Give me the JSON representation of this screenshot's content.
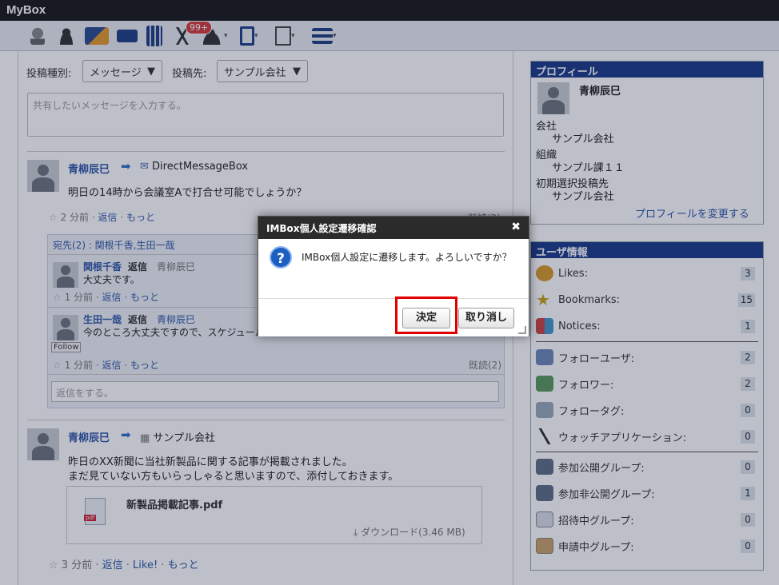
{
  "app": {
    "title": "MyBox"
  },
  "toolbar": {
    "badge": "99+"
  },
  "compose": {
    "type_label": "投稿種別:",
    "type_value": "メッセージ",
    "dest_label": "投稿先:",
    "dest_value": "サンプル会社",
    "placeholder": "共有したいメッセージを入力する。"
  },
  "post1": {
    "author": "青柳辰巳",
    "dest": "DirectMessageBox",
    "body": "明日の14時から会議室Aで打合せ可能でしょうか？",
    "time": "2 分前",
    "reply": "返信",
    "more": "もっと",
    "read": "既読(2)",
    "recipients": "宛先(2) : 関根千香,生田一哉",
    "replies": [
      {
        "author": "関根千香",
        "reply_label": "返信",
        "to": "青柳辰巳",
        "body": "大丈夫です。",
        "time": "1 分前",
        "reply": "返信",
        "more": "もっと"
      },
      {
        "author": "生田一哉",
        "reply_label": "返信",
        "to": "青柳辰巳",
        "body": "今のところ大丈夫ですので、スケジュール",
        "time": "1 分前",
        "reply": "返信",
        "more": "もっと",
        "follow": "Follow",
        "read": "既読(2)"
      }
    ],
    "reply_placeholder": "返信をする。"
  },
  "post2": {
    "author": "青柳辰巳",
    "dest": "サンプル会社",
    "body1": "昨日のXX新聞に当社新製品に関する記事が掲載されました。",
    "body2": "まだ見ていない方もいらっしゃると思いますので、添付しておきます。",
    "file": "新製品掲載記事.pdf",
    "pdf_label": "pdf",
    "download": "ダウンロード(3.46 MB)",
    "time": "3 分前",
    "reply": "返信",
    "like": "Like!",
    "more": "もっと"
  },
  "profile": {
    "header": "プロフィール",
    "name": "青柳辰巳",
    "company_label": "会社",
    "company": "サンプル会社",
    "org_label": "組織",
    "org": "サンプル課１１",
    "default_label": "初期選択投稿先",
    "default": "サンプル会社",
    "change_link": "プロフィールを変更する"
  },
  "userinfo": {
    "header": "ユーザ情報",
    "items": [
      {
        "label": "Likes:",
        "count": "3"
      },
      {
        "label": "Bookmarks:",
        "count": "15"
      },
      {
        "label": "Notices:",
        "count": "1"
      },
      {
        "label": "フォローユーザ:",
        "count": "2"
      },
      {
        "label": "フォロワー:",
        "count": "2"
      },
      {
        "label": "フォロータグ:",
        "count": "0"
      },
      {
        "label": "ウォッチアプリケーション:",
        "count": "0"
      },
      {
        "label": "参加公開グループ:",
        "count": "0"
      },
      {
        "label": "参加非公開グループ:",
        "count": "1"
      },
      {
        "label": "招待中グループ:",
        "count": "0"
      },
      {
        "label": "申請中グループ:",
        "count": "0"
      }
    ]
  },
  "dialog": {
    "title": "IMBox個人設定遷移確認",
    "message": "IMBox個人設定に遷移します。よろしいですか？",
    "ok": "決定",
    "cancel": "取り消し"
  }
}
